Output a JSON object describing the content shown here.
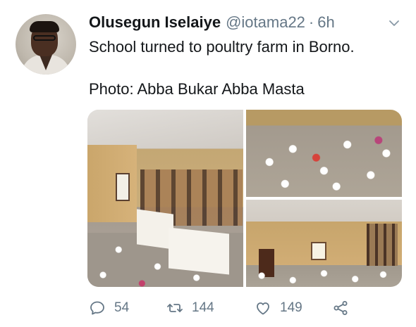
{
  "tweet": {
    "author_name": "Olusegun Iselaiye",
    "author_handle": "@iotama22",
    "separator": "·",
    "timestamp": "6h",
    "text_line1": "School turned to poultry farm in Borno.",
    "text_line2": "Photo: Abba Bukar Abba Masta"
  },
  "media": {
    "photos": [
      "classroom-with-chickens",
      "chickens-on-floor",
      "hall-with-chickens"
    ]
  },
  "actions": {
    "reply_count": "54",
    "retweet_count": "144",
    "like_count": "149"
  },
  "icons": {
    "menu": "chevron-down-icon",
    "reply": "reply-icon",
    "retweet": "retweet-icon",
    "like": "heart-icon",
    "share": "share-icon"
  },
  "colors": {
    "text_primary": "#14171a",
    "text_secondary": "#657786",
    "background": "#ffffff"
  }
}
